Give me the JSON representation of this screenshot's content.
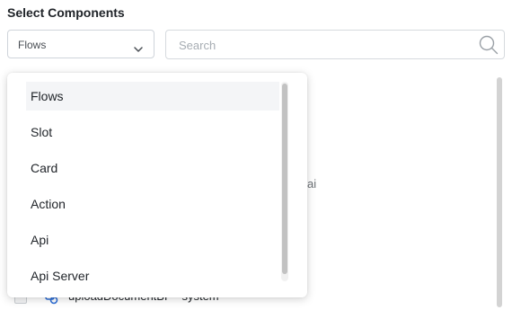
{
  "header": {
    "title": "Select Components"
  },
  "component_select": {
    "value": "Flows",
    "icon": "chevron-down-icon"
  },
  "search": {
    "placeholder": "Search",
    "value": "",
    "icon": "search-icon"
  },
  "dropdown": {
    "options": [
      "Flows",
      "Slot",
      "Card",
      "Action",
      "Api",
      "Api Server"
    ],
    "selected": "Flows"
  },
  "background_list": {
    "fragment": "ai",
    "partial_row": {
      "label": "uploadDocumentBF - system",
      "icon": "component-icon"
    }
  },
  "colors": {
    "highlight": "#f4f5f7",
    "border": "#cfd4da",
    "icon_blue": "#2f6fd6"
  }
}
